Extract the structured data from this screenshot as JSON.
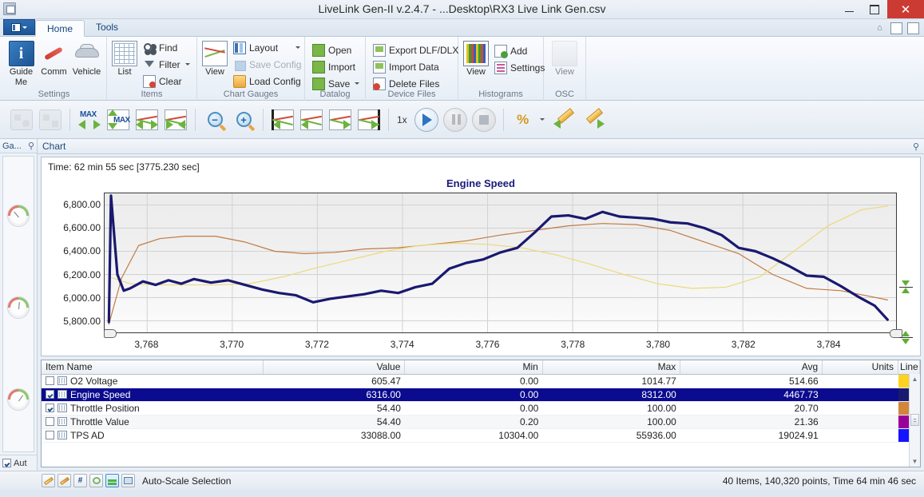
{
  "window": {
    "title": "LiveLink Gen-II  v.2.4.7 - ...Desktop\\RX3 Live Link Gen.csv",
    "app_icon": "app-icon",
    "minimize": "–",
    "maximize": "▢",
    "close": "✕"
  },
  "ribbon": {
    "app_button": "file-menu",
    "tabs": [
      {
        "label": "Home",
        "active": true
      },
      {
        "label": "Tools",
        "active": false
      }
    ],
    "quick_icons": [
      "help-icon",
      "export-icon",
      "import-icon"
    ],
    "groups": [
      {
        "name": "Settings",
        "label": "Settings",
        "big_buttons": [
          {
            "label": "Guide\nMe",
            "line1": "Guide",
            "line2": "Me",
            "icon": "info-icon"
          },
          {
            "label": "Comm",
            "line1": "Comm",
            "line2": "",
            "icon": "comm-icon"
          },
          {
            "label": "Vehicle",
            "line1": "Vehicle",
            "line2": "",
            "icon": "vehicle-icon"
          }
        ],
        "small_buttons": []
      },
      {
        "name": "Items",
        "label": "Items",
        "big_buttons": [
          {
            "line1": "List",
            "line2": "",
            "icon": "list-icon"
          }
        ],
        "small_buttons": [
          {
            "label": "Find",
            "icon": "find-icon",
            "disabled": false,
            "dropdown": false
          },
          {
            "label": "Filter",
            "icon": "filter-icon",
            "disabled": false,
            "dropdown": true
          },
          {
            "label": "Clear",
            "icon": "clear-icon",
            "disabled": false,
            "dropdown": false
          }
        ]
      },
      {
        "name": "Chart Gauges",
        "label": "Chart  Gauges",
        "big_buttons": [
          {
            "line1": "View",
            "line2": "",
            "icon": "chart-view-icon"
          }
        ],
        "small_buttons": [
          {
            "label": "Layout",
            "icon": "layout-icon",
            "disabled": false,
            "dropdown": true
          },
          {
            "label": "Save Config",
            "icon": "save-config-icon",
            "disabled": true,
            "dropdown": false
          },
          {
            "label": "Load Config",
            "icon": "load-config-icon",
            "disabled": false,
            "dropdown": false
          }
        ]
      },
      {
        "name": "Datalog",
        "label": "Datalog",
        "big_buttons": [],
        "small_buttons": [
          {
            "label": "Open",
            "icon": "open-icon",
            "disabled": false,
            "dropdown": false
          },
          {
            "label": "Import",
            "icon": "import-icon",
            "disabled": false,
            "dropdown": false
          },
          {
            "label": "Save",
            "icon": "save-icon",
            "disabled": false,
            "dropdown": true
          }
        ]
      },
      {
        "name": "Device Files",
        "label": "Device Files",
        "big_buttons": [],
        "small_buttons": [
          {
            "label": "Export DLF/DLX",
            "icon": "export-dlf-icon",
            "disabled": false,
            "dropdown": false
          },
          {
            "label": "Import Data",
            "icon": "import-data-icon",
            "disabled": false,
            "dropdown": false
          },
          {
            "label": "Delete Files",
            "icon": "delete-files-icon",
            "disabled": false,
            "dropdown": false
          }
        ]
      },
      {
        "name": "Histograms",
        "label": "Histograms",
        "big_buttons": [
          {
            "line1": "View",
            "line2": "",
            "icon": "histogram-icon"
          }
        ],
        "small_buttons": [
          {
            "label": "Add",
            "icon": "add-icon",
            "disabled": false,
            "dropdown": false
          },
          {
            "label": "Settings",
            "icon": "settings-icon",
            "disabled": false,
            "dropdown": false
          }
        ]
      },
      {
        "name": "OSC",
        "label": "OSC",
        "big_buttons": [
          {
            "line1": "View",
            "line2": "",
            "icon": "osc-icon",
            "disabled": true
          }
        ],
        "small_buttons": []
      }
    ]
  },
  "toolbar": {
    "speed_label": "1x",
    "buttons": [
      {
        "name": "record-button",
        "disabled": true
      },
      {
        "name": "record-stop-button",
        "disabled": true
      },
      {
        "name": "max-horizontal-button",
        "disabled": false
      },
      {
        "name": "max-vertical-button",
        "disabled": false
      },
      {
        "name": "expand-chart-button",
        "disabled": false
      },
      {
        "name": "collapse-chart-button",
        "disabled": false
      },
      {
        "name": "zoom-out-button",
        "disabled": false
      },
      {
        "name": "zoom-in-button",
        "disabled": false
      },
      {
        "name": "goto-start-button",
        "disabled": false
      },
      {
        "name": "step-back-button",
        "disabled": false
      },
      {
        "name": "step-forward-button",
        "disabled": false
      },
      {
        "name": "goto-end-button",
        "disabled": false
      },
      {
        "name": "play-button",
        "disabled": false
      },
      {
        "name": "pause-button",
        "disabled": true
      },
      {
        "name": "stop-button",
        "disabled": true
      },
      {
        "name": "percent-button",
        "disabled": false
      },
      {
        "name": "edit-back-button",
        "disabled": false
      },
      {
        "name": "edit-forward-button",
        "disabled": false
      }
    ]
  },
  "gauges_panel": {
    "title": "Ga...",
    "pin_icon": "pin-icon",
    "autoscale_label": "Aut",
    "autoscale_checked": true,
    "gauge_count": 3
  },
  "chart_panel": {
    "title": "Chart",
    "pin_icon": "pin-icon",
    "time_label": "Time: 62 min 55 sec [3775.230 sec]"
  },
  "chart_data": {
    "type": "line",
    "title": "Engine Speed",
    "xlabel": "",
    "ylabel": "",
    "grid": true,
    "legend_position": "none",
    "ylim": [
      5700,
      6900
    ],
    "xlim": [
      3767.0,
      3785.6
    ],
    "ytick_labels": [
      "6,800.00",
      "6,600.00",
      "6,400.00",
      "6,200.00",
      "6,000.00",
      "5,800.00"
    ],
    "yticks": [
      6800,
      6600,
      6400,
      6200,
      6000,
      5800
    ],
    "xtick_labels": [
      "3,768",
      "3,770",
      "3,772",
      "3,774",
      "3,776",
      "3,778",
      "3,780",
      "3,782",
      "3,784"
    ],
    "xticks": [
      3768,
      3770,
      3772,
      3774,
      3776,
      3778,
      3780,
      3782,
      3784
    ],
    "series": [
      {
        "name": "Engine Speed",
        "color": "#191970",
        "width": 3.2,
        "x": [
          3767.1,
          3767.15,
          3767.3,
          3767.45,
          3767.6,
          3767.9,
          3768.2,
          3768.5,
          3768.8,
          3769.1,
          3769.5,
          3769.9,
          3770.3,
          3770.7,
          3771.1,
          3771.5,
          3771.9,
          3772.3,
          3772.7,
          3773.1,
          3773.5,
          3773.9,
          3774.3,
          3774.7,
          3775.1,
          3775.5,
          3775.9,
          3776.3,
          3776.7,
          3777.1,
          3777.5,
          3777.9,
          3778.3,
          3778.7,
          3779.1,
          3779.5,
          3779.9,
          3780.3,
          3780.7,
          3781.1,
          3781.5,
          3781.9,
          3782.3,
          3782.7,
          3783.1,
          3783.5,
          3783.9,
          3784.3,
          3784.7,
          3785.1,
          3785.4
        ],
        "y": [
          5790,
          6880,
          6200,
          6060,
          6080,
          6140,
          6110,
          6150,
          6120,
          6160,
          6130,
          6150,
          6110,
          6070,
          6040,
          6020,
          5960,
          5990,
          6010,
          6030,
          6060,
          6040,
          6090,
          6120,
          6250,
          6300,
          6330,
          6390,
          6430,
          6560,
          6700,
          6710,
          6680,
          6740,
          6700,
          6690,
          6680,
          6650,
          6640,
          6600,
          6540,
          6430,
          6400,
          6340,
          6270,
          6190,
          6180,
          6100,
          6010,
          5930,
          5810
        ]
      },
      {
        "name": "Throttle Position",
        "color": "#c27a42",
        "width": 1.2,
        "x": [
          3767.1,
          3767.4,
          3767.8,
          3768.3,
          3768.9,
          3769.6,
          3770.3,
          3771.0,
          3771.7,
          3772.4,
          3773.1,
          3773.9,
          3774.7,
          3775.5,
          3776.3,
          3777.1,
          3777.9,
          3778.7,
          3779.5,
          3780.3,
          3781.1,
          3781.9,
          3782.7,
          3783.5,
          3784.3,
          3785.0,
          3785.4
        ],
        "y": [
          5770,
          6170,
          6450,
          6510,
          6530,
          6530,
          6480,
          6400,
          6380,
          6390,
          6420,
          6430,
          6460,
          6490,
          6540,
          6580,
          6620,
          6640,
          6630,
          6580,
          6480,
          6380,
          6200,
          6080,
          6060,
          6010,
          5980
        ]
      },
      {
        "name": "O2 Voltage",
        "color": "#ecd97c",
        "width": 1.2,
        "x": [
          3767.1,
          3767.6,
          3768.2,
          3768.8,
          3769.6,
          3770.4,
          3771.2,
          3772.0,
          3772.8,
          3773.6,
          3774.4,
          3775.2,
          3776.0,
          3776.8,
          3777.6,
          3778.4,
          3779.2,
          3780.0,
          3780.8,
          3781.6,
          3782.4,
          3783.2,
          3784.0,
          3784.8,
          3785.4
        ],
        "y": [
          6180,
          6120,
          6110,
          6110,
          6110,
          6120,
          6180,
          6260,
          6330,
          6400,
          6450,
          6470,
          6460,
          6430,
          6370,
          6290,
          6200,
          6120,
          6080,
          6090,
          6180,
          6400,
          6620,
          6760,
          6790
        ]
      }
    ]
  },
  "items_table": {
    "columns": [
      "Item Name",
      "Value",
      "Min",
      "Max",
      "Avg",
      "Units",
      "Line"
    ],
    "rows": [
      {
        "checked": false,
        "selected": false,
        "name": "O2 Voltage",
        "value": "605.47",
        "min": "0.00",
        "max": "1014.77",
        "avg": "514.66",
        "units": "",
        "line_color": "#FFD21E"
      },
      {
        "checked": true,
        "selected": true,
        "name": "Engine Speed",
        "value": "6316.00",
        "min": "0.00",
        "max": "8312.00",
        "avg": "4467.73",
        "units": "",
        "line_color": "#191970"
      },
      {
        "checked": true,
        "selected": false,
        "name": "Throttle Position",
        "value": "54.40",
        "min": "0.00",
        "max": "100.00",
        "avg": "20.70",
        "units": "",
        "line_color": "#D2863C"
      },
      {
        "checked": false,
        "selected": false,
        "name": "Throttle Value",
        "value": "54.40",
        "min": "0.20",
        "max": "100.00",
        "avg": "21.36",
        "units": "",
        "line_color": "#990099"
      },
      {
        "checked": false,
        "selected": false,
        "name": "TPS AD",
        "value": "33088.00",
        "min": "10304.00",
        "max": "55936.00",
        "avg": "19024.91",
        "units": "",
        "line_color": "#1414FF"
      }
    ]
  },
  "statusbar": {
    "mode_label": "Auto-Scale Selection",
    "summary": "40 Items, 140,320 points, Time 64 min 46 sec",
    "buttons": [
      {
        "name": "marker-green-button",
        "glyph": ""
      },
      {
        "name": "marker-red-button",
        "glyph": ""
      },
      {
        "name": "hash-button",
        "glyph": "#"
      },
      {
        "name": "cycle-button",
        "glyph": ""
      },
      {
        "name": "autoscale-button",
        "glyph": "",
        "active": true
      },
      {
        "name": "scale-selection-button",
        "glyph": ""
      }
    ]
  }
}
